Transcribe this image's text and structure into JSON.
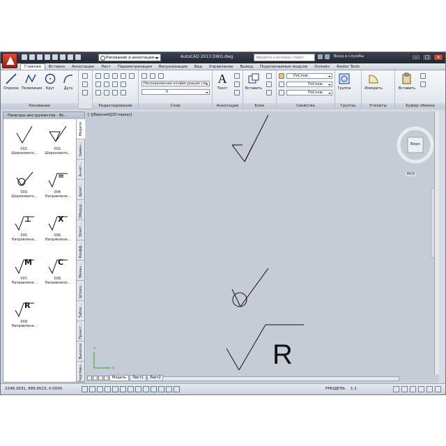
{
  "title_bar": {
    "workspace": "Рисование и аннотации",
    "app_title": "AutoCAD 2013   DWG.dwg",
    "search_placeholder": "Введите ключевое слово/фразу",
    "sign_in": "Вход в службы"
  },
  "menu_tabs": [
    "Главная",
    "Вставка",
    "Аннотации",
    "Лист",
    "Параметризация",
    "Визуализация",
    "Вид",
    "Управление",
    "Вывод",
    "Подключаемые модули",
    "Онлайн",
    "Raster Tools"
  ],
  "ribbon": {
    "draw_buttons": [
      "Отрезок",
      "Полилиния",
      "Круг",
      "Дуга"
    ],
    "panels": [
      "Рисование",
      "Редактирование",
      "Слои",
      "Аннотации",
      "Блок",
      "Свойства",
      "Группы",
      "Утилиты",
      "Буфер обмена"
    ],
    "layer_state": "Несохраненная конфигурация сло",
    "layer_name": "0",
    "text_button": "Текст",
    "insert_button": "Вставить",
    "group_button": "Группа",
    "measure_button": "Измерить",
    "paste_button": "Вставить",
    "color": "ПоСлою",
    "linetype": "ПоСлою",
    "lineweight": "ПоСлою"
  },
  "palette": {
    "title": "Палитры инструментов - Вс...",
    "tabs": [
      "Модели",
      "Замен...",
      "Аннот...",
      "Архит...",
      "Оборуд...",
      "Элект...",
      "Коэфф...",
      "Механ...",
      "Штрих...",
      "Табли...",
      "Проект...",
      "Выноски",
      "Чертёжн..."
    ],
    "tools": [
      {
        "num": "002.",
        "label": "Шероховато...",
        "symbol": "plain"
      },
      {
        "num": "002.",
        "label": "Шероховато...",
        "symbol": "triangle"
      },
      {
        "num": "003.",
        "label": "Шероховато...",
        "symbol": "circle"
      },
      {
        "num": "004.",
        "label": "Направлени...",
        "symbol": "text",
        "mark": "="
      },
      {
        "num": "005.",
        "label": "Направлени...",
        "symbol": "text",
        "mark": "⊥"
      },
      {
        "num": "006.",
        "label": "Направлени...",
        "symbol": "text",
        "mark": "X"
      },
      {
        "num": "007.",
        "label": "Направлени...",
        "symbol": "text",
        "mark": "M"
      },
      {
        "num": "008.",
        "label": "Направлени...",
        "symbol": "text",
        "mark": "C"
      },
      {
        "num": "009.",
        "label": "Направлени...",
        "symbol": "text",
        "mark": "R"
      }
    ]
  },
  "canvas": {
    "viewport_label": "[–][Верхний][2D каркас]",
    "viewcube_face": "Верх",
    "wcs": "МСК",
    "drawing_mark": "R"
  },
  "layout_tabs": [
    "Модель",
    "Лист1",
    "Лист2"
  ],
  "status": {
    "coords": "2248.2631, 889.9523, 0.0000",
    "model": "РМОДЕЛЬ",
    "scale": "1:1"
  }
}
